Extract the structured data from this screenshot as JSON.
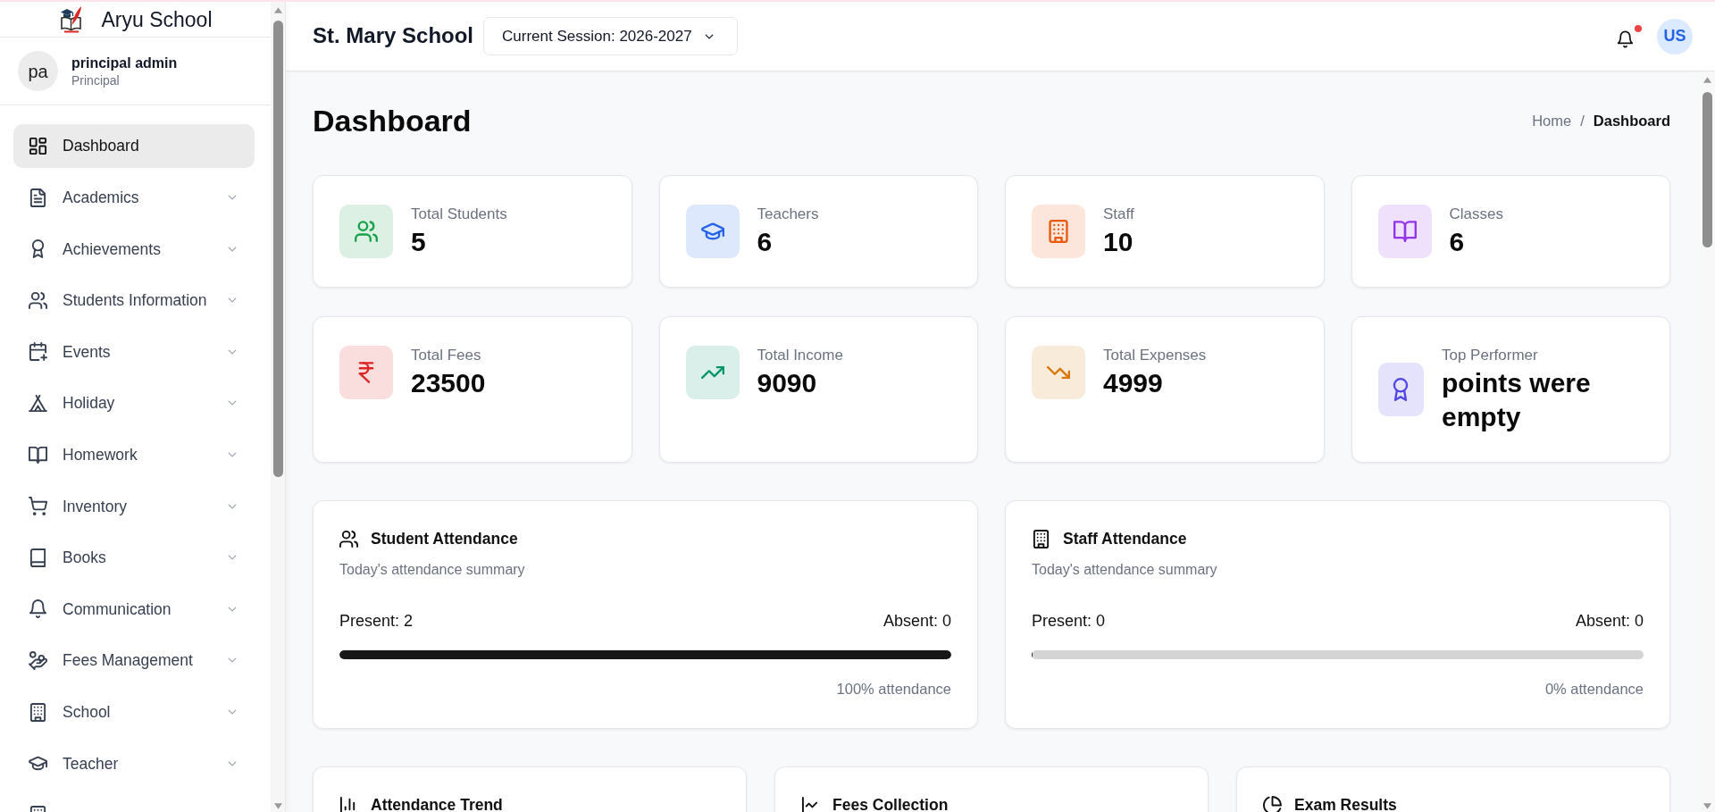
{
  "sidebar": {
    "brand": "Aryu School",
    "user": {
      "initials": "pa",
      "name": "principal admin",
      "role": "Principal"
    },
    "items": [
      {
        "label": "Dashboard",
        "selected": true,
        "expandable": false
      },
      {
        "label": "Academics",
        "selected": false,
        "expandable": true
      },
      {
        "label": "Achievements",
        "selected": false,
        "expandable": true
      },
      {
        "label": "Students Information",
        "selected": false,
        "expandable": true
      },
      {
        "label": "Events",
        "selected": false,
        "expandable": true
      },
      {
        "label": "Holiday",
        "selected": false,
        "expandable": true
      },
      {
        "label": "Homework",
        "selected": false,
        "expandable": true
      },
      {
        "label": "Inventory",
        "selected": false,
        "expandable": true
      },
      {
        "label": "Books",
        "selected": false,
        "expandable": true
      },
      {
        "label": "Communication",
        "selected": false,
        "expandable": true
      },
      {
        "label": "Fees Management",
        "selected": false,
        "expandable": true
      },
      {
        "label": "School",
        "selected": false,
        "expandable": true
      },
      {
        "label": "Teacher",
        "selected": false,
        "expandable": true
      },
      {
        "selected": false
      }
    ]
  },
  "header": {
    "school": "St. Mary School",
    "session": "Current Session: 2026-2027",
    "notifications": {
      "unread": true
    },
    "avatar": "US"
  },
  "page": {
    "title": "Dashboard",
    "breadcrumb": {
      "separator": "/",
      "items": [
        {
          "label": "Home",
          "current": false
        },
        {
          "label": "Dashboard",
          "current": true
        }
      ]
    }
  },
  "stats": [
    {
      "label": "Total Students",
      "value": "5",
      "color": "#16a34a"
    },
    {
      "label": "Teachers",
      "value": "6",
      "color": "#2563eb"
    },
    {
      "label": "Staff",
      "value": "10",
      "color": "#ea580c"
    },
    {
      "label": "Classes",
      "value": "6",
      "color": "#9333ea"
    },
    {
      "label": "Total Fees",
      "value": "23500",
      "color": "#dc2626"
    },
    {
      "label": "Total Income",
      "value": "9090",
      "color": "#059669"
    },
    {
      "label": "Total Expenses",
      "value": "4999",
      "color": "#d97706"
    },
    {
      "label": "Top Performer",
      "value": "points were empty",
      "color": "#4f46e5"
    }
  ],
  "attendance": [
    {
      "title": "Student Attendance",
      "subtitle": "Today's attendance summary",
      "present": "Present: 2",
      "absent": "Absent: 0",
      "level": 1,
      "summary": "100% attendance"
    },
    {
      "title": "Staff Attendance",
      "subtitle": "Today's attendance summary",
      "present": "Present: 0",
      "absent": "Absent: 0",
      "level": 0,
      "summary": "0% attendance"
    }
  ],
  "charts": [
    {
      "title": "Attendance Trend"
    },
    {
      "title": "Fees Collection"
    },
    {
      "title": "Exam Results"
    }
  ]
}
